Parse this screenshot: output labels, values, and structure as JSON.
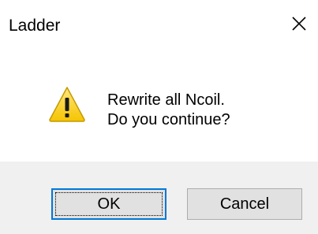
{
  "window": {
    "title": "Ladder",
    "close_icon": "close-icon"
  },
  "message": {
    "icon": "warning-icon",
    "line1": "Rewrite all Ncoil.",
    "line2": "Do you continue?"
  },
  "buttons": {
    "ok_label": "OK",
    "cancel_label": "Cancel"
  },
  "colors": {
    "footer_background": "#f0f0f0",
    "button_background": "#e1e1e1",
    "focus_border": "#0078d7",
    "warning_yellow": "#fcd116"
  }
}
